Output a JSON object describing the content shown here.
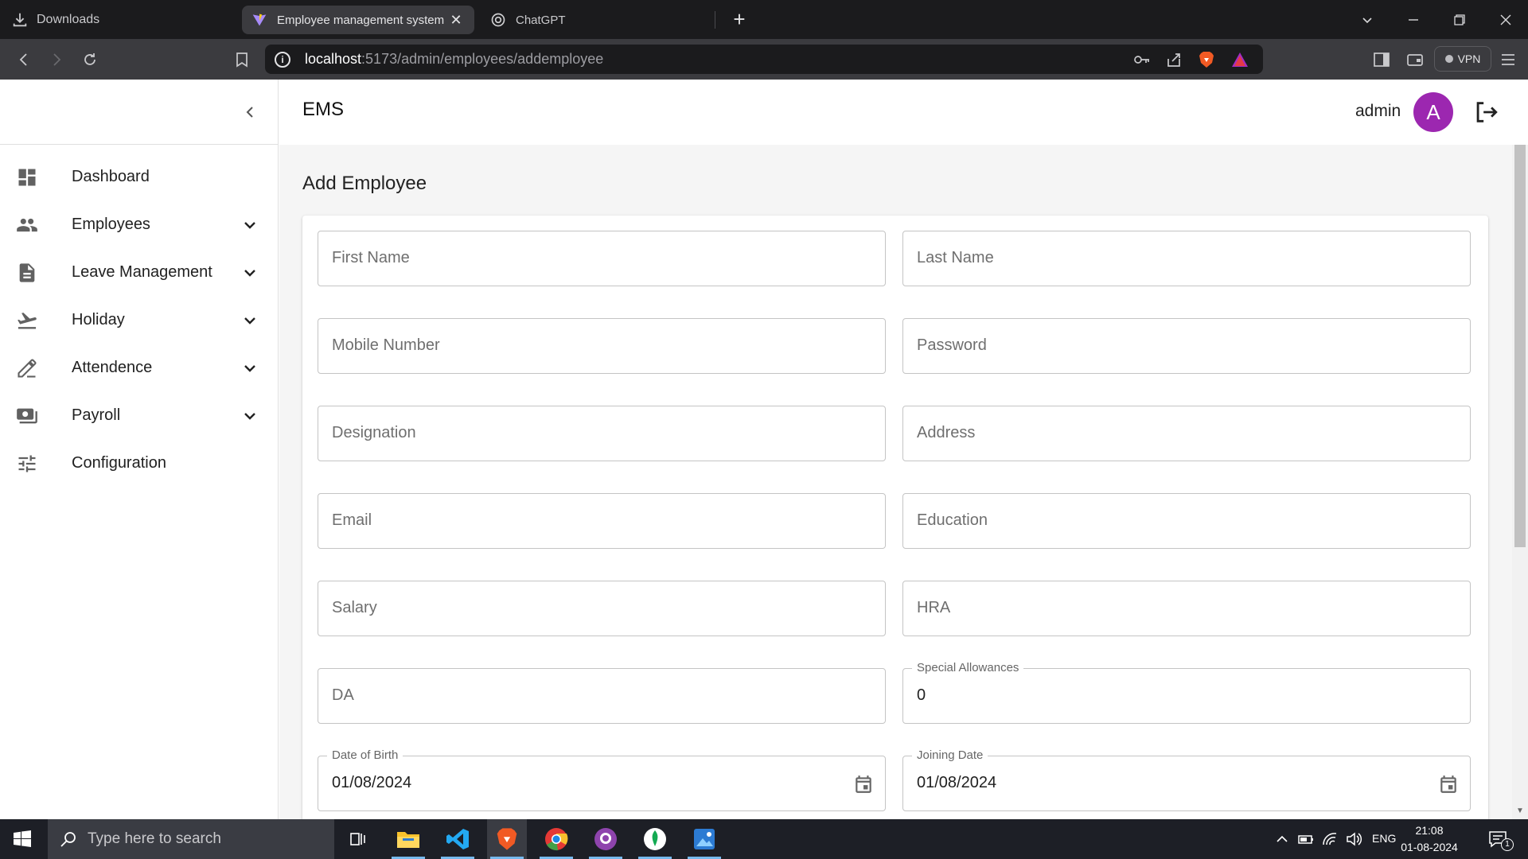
{
  "browser": {
    "downloads_label": "Downloads",
    "tabs": [
      {
        "title": "Employee management system",
        "active": true
      },
      {
        "title": "ChatGPT",
        "active": false
      }
    ],
    "new_tab": "+",
    "url_host": "localhost",
    "url_path": ":5173/admin/employees/addemployee",
    "vpn_label": "VPN"
  },
  "app": {
    "title": "EMS",
    "user": {
      "name": "admin",
      "avatar_initial": "A",
      "avatar_color": "#9c27b0"
    }
  },
  "sidebar": {
    "items": [
      {
        "label": "Dashboard",
        "icon": "dashboard-icon",
        "expandable": false
      },
      {
        "label": "Employees",
        "icon": "people-icon",
        "expandable": true
      },
      {
        "label": "Leave Management",
        "icon": "document-icon",
        "expandable": true
      },
      {
        "label": "Holiday",
        "icon": "flight-takeoff-icon",
        "expandable": true
      },
      {
        "label": "Attendence",
        "icon": "edit-icon",
        "expandable": true
      },
      {
        "label": "Payroll",
        "icon": "payments-icon",
        "expandable": true
      },
      {
        "label": "Configuration",
        "icon": "tune-icon",
        "expandable": false
      }
    ]
  },
  "form": {
    "title": "Add Employee",
    "first_name": {
      "placeholder": "First Name"
    },
    "last_name": {
      "placeholder": "Last Name"
    },
    "mobile": {
      "placeholder": "Mobile Number"
    },
    "password": {
      "placeholder": "Password"
    },
    "designation": {
      "placeholder": "Designation"
    },
    "address": {
      "placeholder": "Address"
    },
    "email": {
      "placeholder": "Email"
    },
    "education": {
      "placeholder": "Education"
    },
    "salary": {
      "placeholder": "Salary"
    },
    "hra": {
      "placeholder": "HRA"
    },
    "da": {
      "placeholder": "DA"
    },
    "special_allowances": {
      "label": "Special Allowances",
      "value": "0"
    },
    "dob": {
      "label": "Date of Birth",
      "value": "01/08/2024"
    },
    "joining_date": {
      "label": "Joining Date",
      "value": "01/08/2024"
    }
  },
  "taskbar": {
    "search_placeholder": "Type here to search",
    "language": "ENG",
    "time": "21:08",
    "date": "01-08-2024",
    "notification_count": "1"
  },
  "colors": {
    "accent": "#9c27b0",
    "chrome_dark": "#1b1b1d",
    "chrome_toolbar": "#3b3b3f",
    "taskbar": "#1d1f26"
  }
}
